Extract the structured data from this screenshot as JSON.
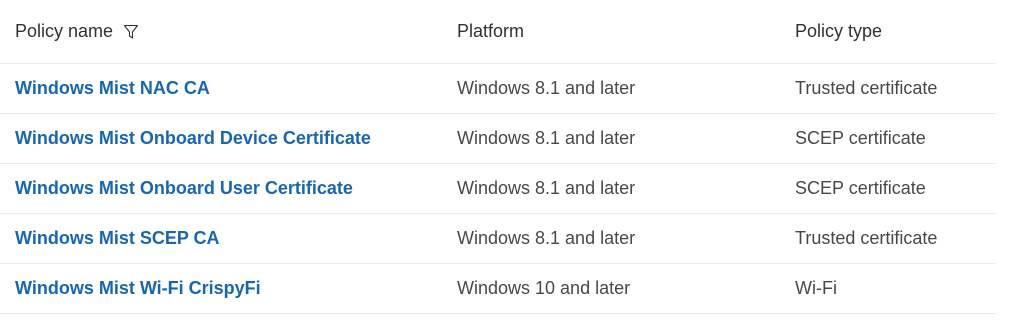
{
  "table": {
    "headers": {
      "name": "Policy name",
      "platform": "Platform",
      "type": "Policy type"
    },
    "filter_icon": "filter-icon",
    "rows": [
      {
        "name": "Windows Mist NAC CA",
        "platform": "Windows 8.1 and later",
        "type": "Trusted certificate"
      },
      {
        "name": "Windows Mist Onboard Device Certificate",
        "platform": "Windows 8.1 and later",
        "type": "SCEP certificate"
      },
      {
        "name": "Windows Mist Onboard User Certificate",
        "platform": "Windows 8.1 and later",
        "type": "SCEP certificate"
      },
      {
        "name": "Windows Mist SCEP CA",
        "platform": "Windows 8.1 and later",
        "type": "Trusted certificate"
      },
      {
        "name": "Windows Mist Wi-Fi CrispyFi",
        "platform": "Windows 10 and later",
        "type": "Wi-Fi"
      }
    ]
  },
  "colors": {
    "link": "#1766b5",
    "text": "#323130",
    "divider": "#edebe9"
  }
}
